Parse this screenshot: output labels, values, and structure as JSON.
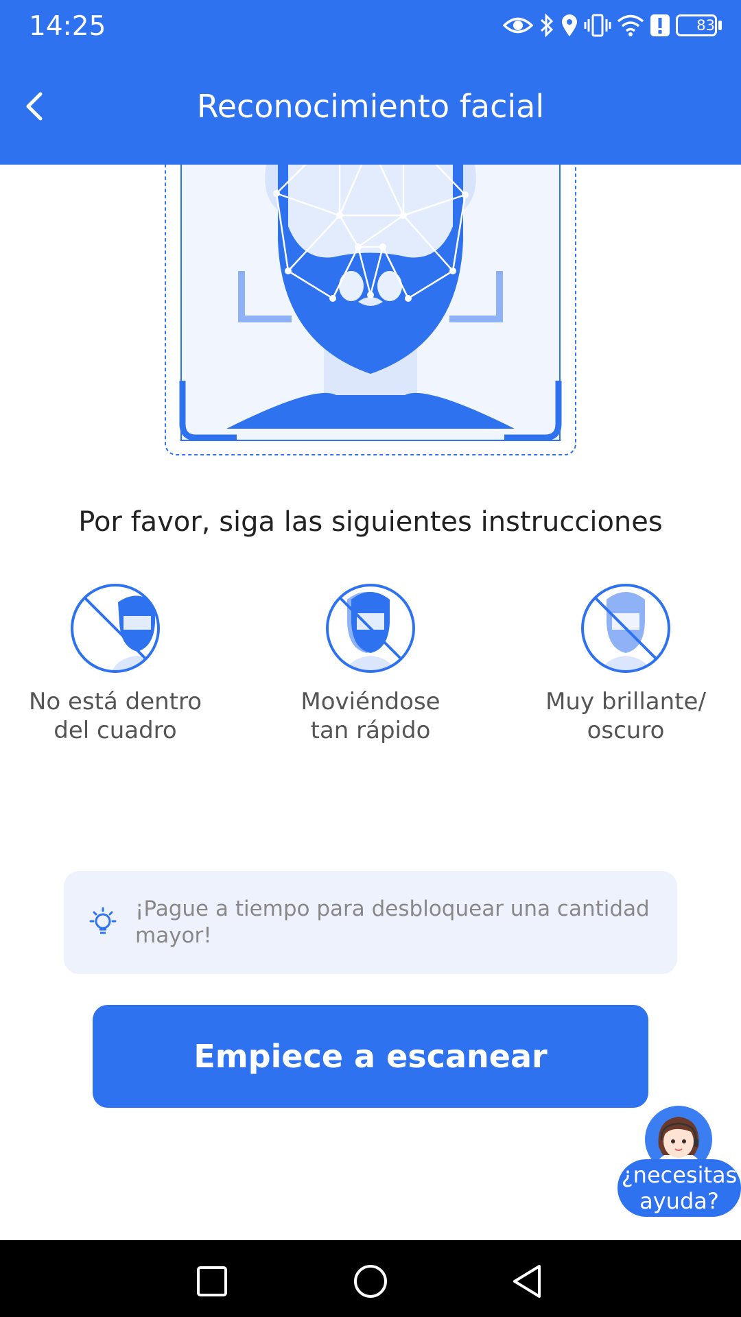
{
  "status_bar": {
    "time": "14:25",
    "battery": "83",
    "icons": [
      "eye-icon",
      "bluetooth-icon",
      "location-icon",
      "vibrate-icon",
      "wifi-icon",
      "alert-icon",
      "battery-icon"
    ]
  },
  "header": {
    "title": "Reconocimiento facial",
    "back_icon": "chevron-left-icon",
    "color": "#2e72f0"
  },
  "instructions": {
    "title": "Por favor, siga las siguientes instrucciones",
    "tips": [
      {
        "label": "No está dentro del cuadro",
        "icon": "face-out-of-frame-icon"
      },
      {
        "label": "Moviéndose tan rápido",
        "icon": "face-moving-fast-icon"
      },
      {
        "label": "Muy brillante/ oscuro",
        "icon": "face-bad-lighting-icon"
      }
    ]
  },
  "notice": {
    "icon": "lightbulb-icon",
    "text": "¡Pague a tiempo para desbloquear una cantidad mayor!"
  },
  "primary_button": {
    "label": "Empiece a escanear"
  },
  "help": {
    "label": "¿necesitas ayuda?",
    "avatar": "support-agent-avatar"
  },
  "nav_bar": {
    "icons": [
      "recents-square-icon",
      "home-circle-icon",
      "back-triangle-icon"
    ]
  }
}
